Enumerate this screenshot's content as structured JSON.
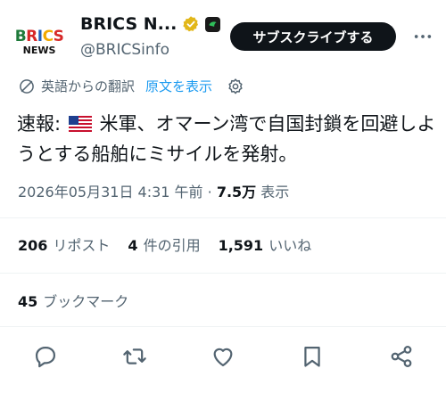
{
  "header": {
    "avatar_text_top": "BRICS",
    "avatar_text_bottom": "NEWS",
    "account_name": "BRICS N...",
    "handle": "@BRICSinfo",
    "subscribe_label": "サブスクライブする"
  },
  "translation": {
    "label": "英語からの翻訳",
    "show_original": "原文を表示"
  },
  "tweet": {
    "prefix": "速報:",
    "body": "米軍、オマーン湾で自国封鎖を回避しようとする船舶にミサイルを発射。"
  },
  "meta": {
    "datetime": "2026年05月31日 4:31 午前",
    "separator": "·",
    "views_count": "7.5万",
    "views_label": "表示"
  },
  "stats": {
    "reposts_count": "206",
    "reposts_label": "リポスト",
    "quotes_count": "4",
    "quotes_label": "件の引用",
    "likes_count": "1,591",
    "likes_label": "いいね",
    "bookmarks_count": "45",
    "bookmarks_label": "ブックマーク"
  },
  "icons": {
    "more": "more-dots-icon",
    "translate": "translate-icon",
    "gear": "gear-icon",
    "reply": "reply-icon",
    "repost": "repost-icon",
    "like": "heart-icon",
    "bookmark": "bookmark-icon",
    "share": "share-icon",
    "flag": "us-flag-icon"
  },
  "colors": {
    "accent": "#1d9bf0",
    "secondary_text": "#536471",
    "primary_text": "#0f1419",
    "verified_gold": "#e2b719"
  }
}
